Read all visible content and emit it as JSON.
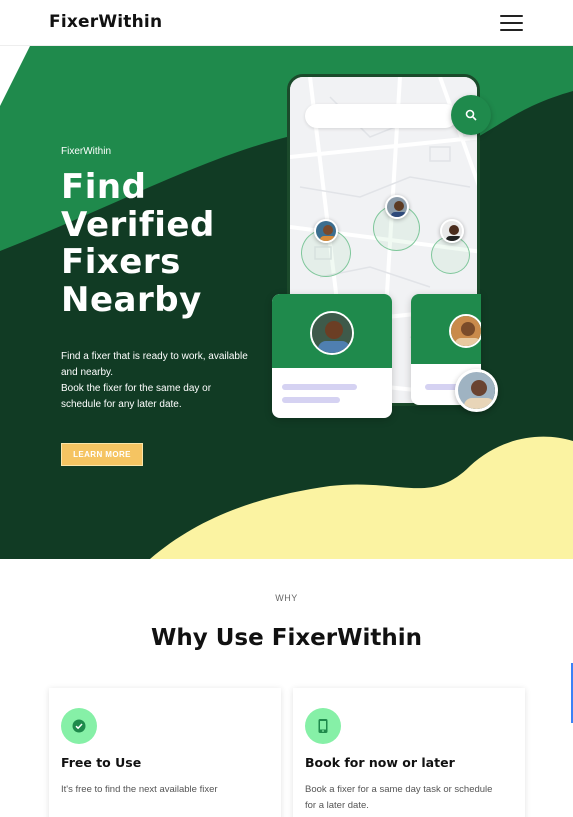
{
  "navbar": {
    "brand": "FixerWithin",
    "menu_icon": "hamburger-menu-icon"
  },
  "hero": {
    "eyebrow": "FixerWithin",
    "title": "Find Verified Fixers Nearby",
    "description": [
      "Find a fixer that is ready to work, available and nearby.",
      "Book the fixer for the same day or schedule for any later date."
    ],
    "cta_label": "LEARN MORE",
    "colors": {
      "dark_green": "#113b24",
      "green": "#1f8a4c",
      "yellow": "#fbf3a2",
      "cta": "#f5c462"
    }
  },
  "why": {
    "label": "WHY",
    "title": "Why Use FixerWithin",
    "features": [
      {
        "icon": "check-badge-icon",
        "title": "Free to Use",
        "description": "It's free to find the next available fixer"
      },
      {
        "icon": "mobile-phone-icon",
        "title": "Book for now or later",
        "description": "Book a fixer for a same day task or schedule for a later date."
      }
    ]
  }
}
